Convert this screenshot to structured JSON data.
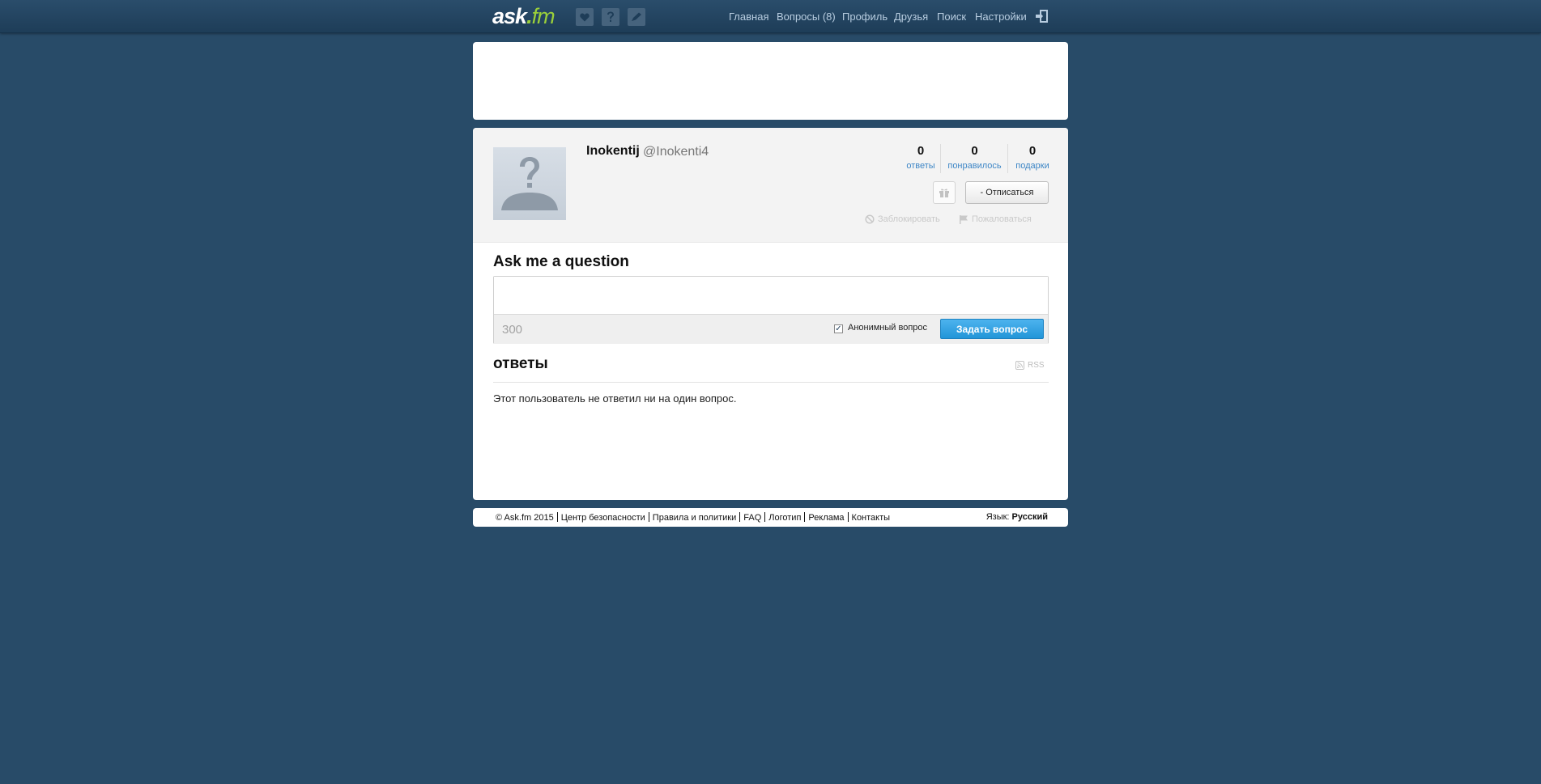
{
  "header": {
    "logo_main": "ask",
    "logo_dot": ".",
    "logo_fm": "fm",
    "nav": [
      "Главная",
      "Вопросы (8)",
      "Профиль",
      "Друзья",
      "Поиск",
      "Настройки"
    ]
  },
  "profile": {
    "name": "Inokentij",
    "username": "@Inokenti4",
    "stats": [
      {
        "value": "0",
        "label": "ответы"
      },
      {
        "value": "0",
        "label": "понравилось"
      },
      {
        "value": "0",
        "label": "подарки"
      }
    ],
    "unsubscribe_label": "- Отписаться",
    "block_label": "Заблокировать",
    "report_label": "Пожаловаться"
  },
  "ask": {
    "title": "Ask me a question",
    "char_count": "300",
    "anonymous_label": "Анонимный вопрос",
    "anonymous_checked": true,
    "submit_label": "Задать вопрос"
  },
  "answers": {
    "title": "ответы",
    "rss_label": "RSS",
    "empty_message": "Этот пользователь не ответил ни на один вопрос."
  },
  "footer": {
    "links": [
      "© Ask.fm 2015",
      "Центр безопасности",
      "Правила и политики",
      "FAQ",
      "Логотип",
      "Реклама",
      "Контакты"
    ],
    "language_prefix": "Язык:",
    "language_value": "Русский"
  },
  "colors": {
    "background": "#284b68",
    "accent": "#9bd03a",
    "button_blue": "#2295d8",
    "link_blue": "#3d86c6"
  }
}
